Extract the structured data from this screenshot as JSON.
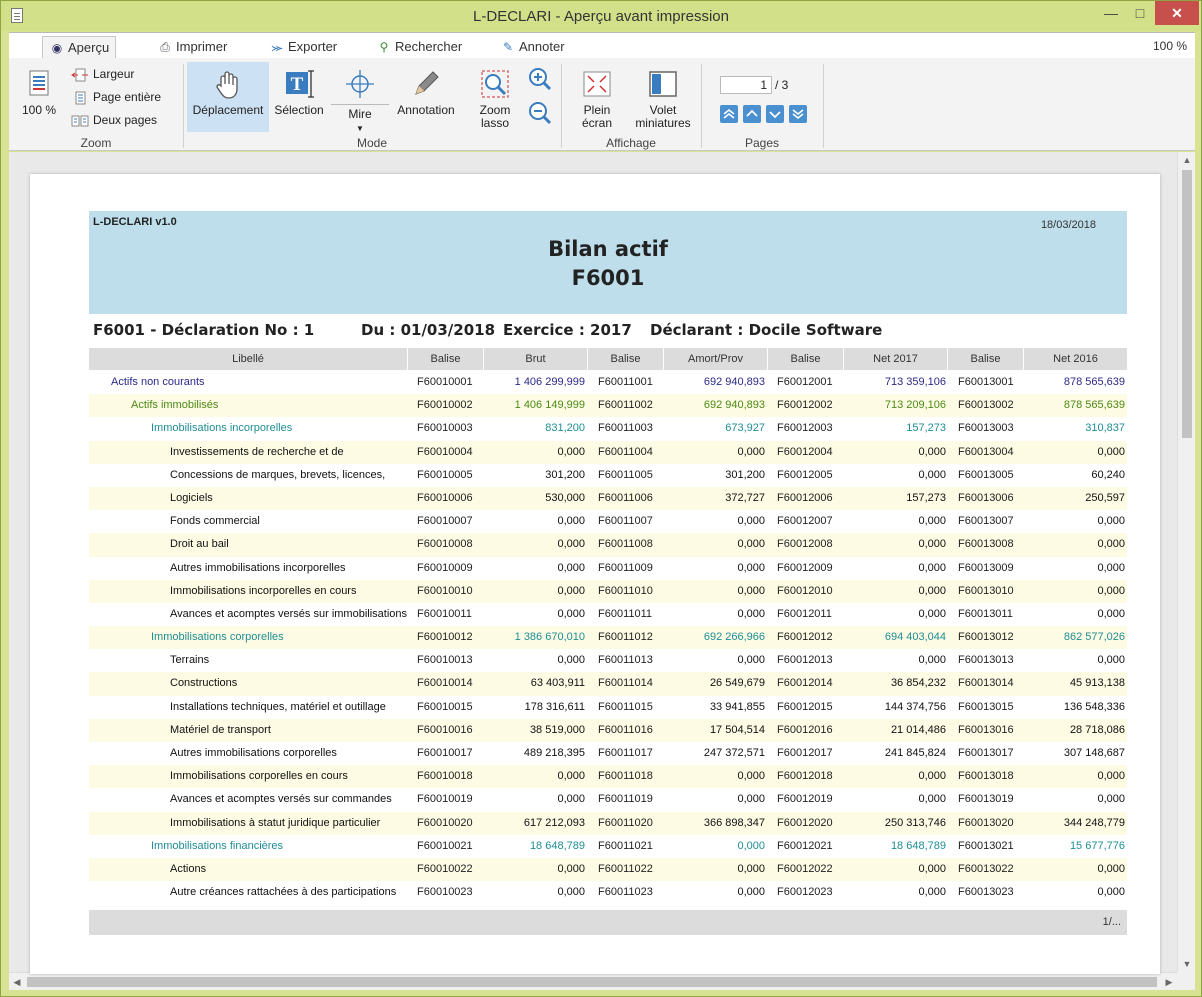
{
  "window": {
    "title": "L-DECLARI - Aperçu avant impression"
  },
  "tabs": [
    {
      "label": "Aperçu",
      "icon": "eye-icon"
    },
    {
      "label": "Imprimer",
      "icon": "printer-icon"
    },
    {
      "label": "Exporter",
      "icon": "share-icon"
    },
    {
      "label": "Rechercher",
      "icon": "search-icon"
    },
    {
      "label": "Annoter",
      "icon": "pen-icon"
    }
  ],
  "zoom_level": "100 %",
  "ribbon": {
    "zoom": {
      "big_label": "100 %",
      "largeur": "Largeur",
      "page_entiere": "Page entière",
      "deux_pages": "Deux pages",
      "group": "Zoom"
    },
    "mode": {
      "deplacement": "Déplacement",
      "selection": "Sélection",
      "mire": "Mire",
      "annotation": "Annotation",
      "zoom_lasso_1": "Zoom",
      "zoom_lasso_2": "lasso",
      "group": "Mode"
    },
    "affichage": {
      "plein_1": "Plein",
      "plein_2": "écran",
      "volet_1": "Volet",
      "volet_2": "miniatures",
      "group": "Affichage"
    },
    "pages": {
      "current": "1",
      "total": "/ 3",
      "group": "Pages"
    }
  },
  "report": {
    "app": "L-DECLARI v1.0",
    "date": "18/03/2018",
    "title": "Bilan actif",
    "code": "F6001",
    "info": {
      "form": "F6001  -  Déclaration No : 1",
      "du": "Du : 01/03/2018",
      "exercice": "Exercice : 2017",
      "declarant": "Déclarant : Docile Software"
    },
    "columns": [
      "Libellé",
      "Balise",
      "Brut",
      "Balise",
      "Amort/Prov",
      "Balise",
      "Net 2017",
      "Balise",
      "Net 2016"
    ],
    "rows": [
      {
        "level": 0,
        "libelle": "Actifs non courants",
        "b1": "F60010001",
        "brut": "1 406 299,999",
        "b2": "F60011001",
        "amort": "692 940,893",
        "b3": "F60012001",
        "net2017": "713 359,106",
        "b4": "F60013001",
        "net2016": "878 565,639"
      },
      {
        "level": 1,
        "libelle": "Actifs immobilisés",
        "b1": "F60010002",
        "brut": "1 406 149,999",
        "b2": "F60011002",
        "amort": "692 940,893",
        "b3": "F60012002",
        "net2017": "713 209,106",
        "b4": "F60013002",
        "net2016": "878 565,639"
      },
      {
        "level": 2,
        "libelle": "Immobilisations incorporelles",
        "b1": "F60010003",
        "brut": "831,200",
        "b2": "F60011003",
        "amort": "673,927",
        "b3": "F60012003",
        "net2017": "157,273",
        "b4": "F60013003",
        "net2016": "310,837"
      },
      {
        "level": 3,
        "libelle": "Investissements de recherche et de",
        "b1": "F60010004",
        "brut": "0,000",
        "b2": "F60011004",
        "amort": "0,000",
        "b3": "F60012004",
        "net2017": "0,000",
        "b4": "F60013004",
        "net2016": "0,000"
      },
      {
        "level": 3,
        "libelle": "Concessions de marques, brevets, licences,",
        "b1": "F60010005",
        "brut": "301,200",
        "b2": "F60011005",
        "amort": "301,200",
        "b3": "F60012005",
        "net2017": "0,000",
        "b4": "F60013005",
        "net2016": "60,240"
      },
      {
        "level": 3,
        "libelle": "Logiciels",
        "b1": "F60010006",
        "brut": "530,000",
        "b2": "F60011006",
        "amort": "372,727",
        "b3": "F60012006",
        "net2017": "157,273",
        "b4": "F60013006",
        "net2016": "250,597"
      },
      {
        "level": 3,
        "libelle": "Fonds commercial",
        "b1": "F60010007",
        "brut": "0,000",
        "b2": "F60011007",
        "amort": "0,000",
        "b3": "F60012007",
        "net2017": "0,000",
        "b4": "F60013007",
        "net2016": "0,000"
      },
      {
        "level": 3,
        "libelle": "Droit au bail",
        "b1": "F60010008",
        "brut": "0,000",
        "b2": "F60011008",
        "amort": "0,000",
        "b3": "F60012008",
        "net2017": "0,000",
        "b4": "F60013008",
        "net2016": "0,000"
      },
      {
        "level": 3,
        "libelle": "Autres immobilisations incorporelles",
        "b1": "F60010009",
        "brut": "0,000",
        "b2": "F60011009",
        "amort": "0,000",
        "b3": "F60012009",
        "net2017": "0,000",
        "b4": "F60013009",
        "net2016": "0,000"
      },
      {
        "level": 3,
        "libelle": "Immobilisations incorporelles en cours",
        "b1": "F60010010",
        "brut": "0,000",
        "b2": "F60011010",
        "amort": "0,000",
        "b3": "F60012010",
        "net2017": "0,000",
        "b4": "F60013010",
        "net2016": "0,000"
      },
      {
        "level": 3,
        "libelle": "Avances et acomptes versés sur immobilisations",
        "b1": "F60010011",
        "brut": "0,000",
        "b2": "F60011011",
        "amort": "0,000",
        "b3": "F60012011",
        "net2017": "0,000",
        "b4": "F60013011",
        "net2016": "0,000"
      },
      {
        "level": 2,
        "libelle": "Immobilisations corporelles",
        "b1": "F60010012",
        "brut": "1 386 670,010",
        "b2": "F60011012",
        "amort": "692 266,966",
        "b3": "F60012012",
        "net2017": "694 403,044",
        "b4": "F60013012",
        "net2016": "862 577,026"
      },
      {
        "level": 3,
        "libelle": "Terrains",
        "b1": "F60010013",
        "brut": "0,000",
        "b2": "F60011013",
        "amort": "0,000",
        "b3": "F60012013",
        "net2017": "0,000",
        "b4": "F60013013",
        "net2016": "0,000"
      },
      {
        "level": 3,
        "libelle": "Constructions",
        "b1": "F60010014",
        "brut": "63 403,911",
        "b2": "F60011014",
        "amort": "26 549,679",
        "b3": "F60012014",
        "net2017": "36 854,232",
        "b4": "F60013014",
        "net2016": "45 913,138"
      },
      {
        "level": 3,
        "libelle": "Installations techniques, matériel et outillage",
        "b1": "F60010015",
        "brut": "178 316,611",
        "b2": "F60011015",
        "amort": "33 941,855",
        "b3": "F60012015",
        "net2017": "144 374,756",
        "b4": "F60013015",
        "net2016": "136 548,336"
      },
      {
        "level": 3,
        "libelle": "Matériel de transport",
        "b1": "F60010016",
        "brut": "38 519,000",
        "b2": "F60011016",
        "amort": "17 504,514",
        "b3": "F60012016",
        "net2017": "21 014,486",
        "b4": "F60013016",
        "net2016": "28 718,086"
      },
      {
        "level": 3,
        "libelle": "Autres immobilisations corporelles",
        "b1": "F60010017",
        "brut": "489 218,395",
        "b2": "F60011017",
        "amort": "247 372,571",
        "b3": "F60012017",
        "net2017": "241 845,824",
        "b4": "F60013017",
        "net2016": "307 148,687"
      },
      {
        "level": 3,
        "libelle": "Immobilisations corporelles en cours",
        "b1": "F60010018",
        "brut": "0,000",
        "b2": "F60011018",
        "amort": "0,000",
        "b3": "F60012018",
        "net2017": "0,000",
        "b4": "F60013018",
        "net2016": "0,000"
      },
      {
        "level": 3,
        "libelle": "Avances et acomptes versés sur commandes",
        "b1": "F60010019",
        "brut": "0,000",
        "b2": "F60011019",
        "amort": "0,000",
        "b3": "F60012019",
        "net2017": "0,000",
        "b4": "F60013019",
        "net2016": "0,000"
      },
      {
        "level": 3,
        "libelle": "Immobilisations à statut juridique particulier",
        "b1": "F60010020",
        "brut": "617 212,093",
        "b2": "F60011020",
        "amort": "366 898,347",
        "b3": "F60012020",
        "net2017": "250 313,746",
        "b4": "F60013020",
        "net2016": "344 248,779"
      },
      {
        "level": 2,
        "libelle": "Immobilisations financières",
        "b1": "F60010021",
        "brut": "18 648,789",
        "b2": "F60011021",
        "amort": "0,000",
        "b3": "F60012021",
        "net2017": "18 648,789",
        "b4": "F60013021",
        "net2016": "15 677,776"
      },
      {
        "level": 3,
        "libelle": "Actions",
        "b1": "F60010022",
        "brut": "0,000",
        "b2": "F60011022",
        "amort": "0,000",
        "b3": "F60012022",
        "net2017": "0,000",
        "b4": "F60013022",
        "net2016": "0,000"
      },
      {
        "level": 3,
        "libelle": "Autre créances rattachées à des participations",
        "b1": "F60010023",
        "brut": "0,000",
        "b2": "F60011023",
        "amort": "0,000",
        "b3": "F60012023",
        "net2017": "0,000",
        "b4": "F60013023",
        "net2016": "0,000"
      }
    ],
    "footer": "1/..."
  }
}
